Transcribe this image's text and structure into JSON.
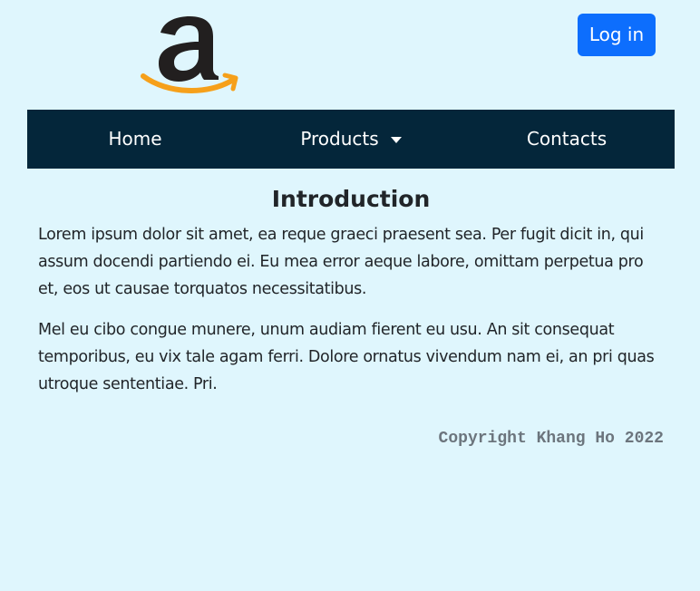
{
  "header": {
    "logo_icon": "amazon-logo-icon",
    "login_label": "Log in"
  },
  "nav": {
    "items": [
      {
        "label": "Home"
      },
      {
        "label": "Products",
        "icon": "caret-down-icon"
      },
      {
        "label": "Contacts"
      }
    ]
  },
  "main": {
    "title": "Introduction",
    "paragraphs": [
      "Lorem ipsum dolor sit amet, ea reque graeci praesent sea. Per fugit dicit in, qui assum docendi partiendo ei. Eu mea error aeque labore, omittam perpetua pro et, eos ut causae torquatos necessitatibus.",
      "Mel eu cibo congue munere, unum audiam fierent eu usu. An sit consequat temporibus, eu vix tale agam ferri. Dolore ornatus vivendum nam ei, an pri quas utroque sententiae. Pri."
    ]
  },
  "footer": {
    "copyright": "Copyright Khang Ho 2022"
  },
  "colors": {
    "background": "#dff6fd",
    "navbar": "#04263a",
    "button": "#0d6efd",
    "logo_text": "#221f1f",
    "logo_smile": "#f6a01a",
    "footer_text": "#6c757d"
  }
}
